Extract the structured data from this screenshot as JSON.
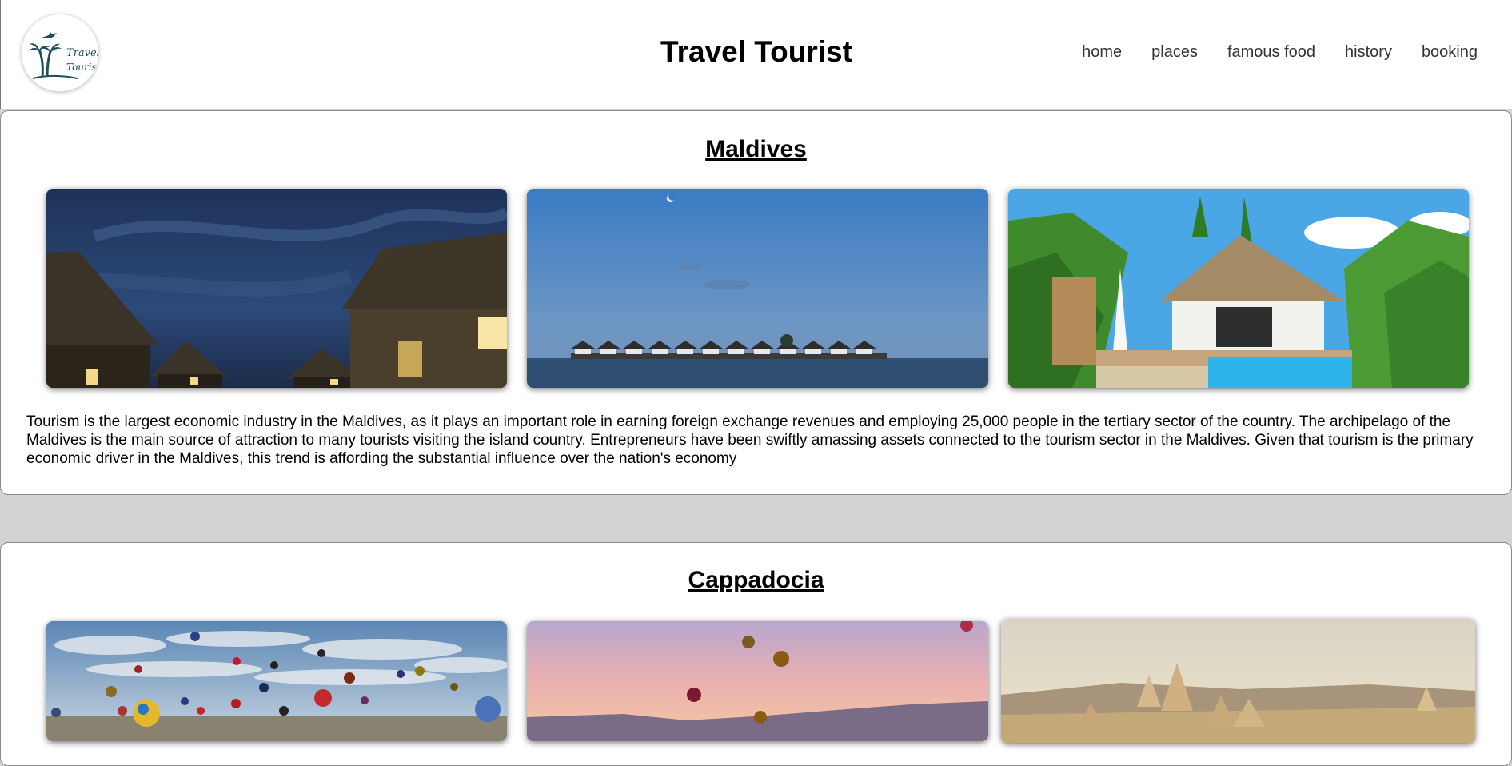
{
  "header": {
    "logo_text_line1": "Travel",
    "logo_text_line2": "Tourist",
    "title": "Travel Tourist",
    "nav": [
      {
        "label": "home"
      },
      {
        "label": "places"
      },
      {
        "label": "famous food"
      },
      {
        "label": "history"
      },
      {
        "label": "booking"
      }
    ]
  },
  "sections": [
    {
      "title": "Maldives",
      "description": "Tourism is the largest economic industry in the Maldives, as it plays an important role in earning foreign exchange revenues and employing 25,000 people in the tertiary sector of the country. The archipelago of the Maldives is the main source of attraction to many tourists visiting the island country. Entrepreneurs have been swiftly amassing assets connected to the tourism sector in the Maldives. Given that tourism is the primary economic driver in the Maldives, this trend is affording the substantial influence over the nation's economy"
    },
    {
      "title": "Cappadocia"
    }
  ],
  "colors": {
    "page_background": "#d3d3d3",
    "panel_background": "#ffffff",
    "logo_accent": "#1f4e5f"
  }
}
